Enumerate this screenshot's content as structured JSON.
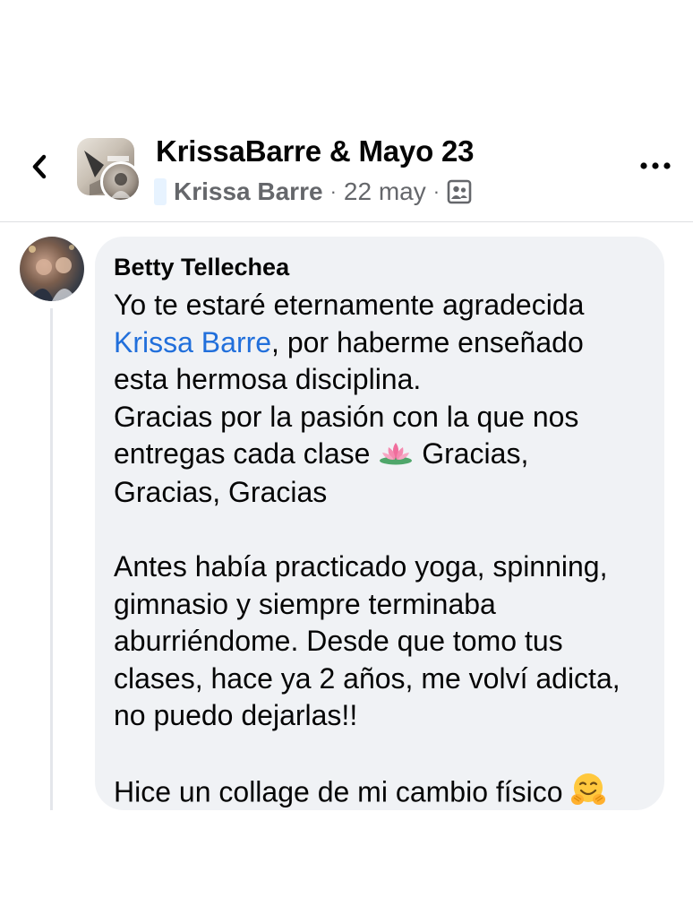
{
  "header": {
    "title": "KrissaBarre & Mayo 23",
    "author": "Krissa Barre",
    "date": "22 may",
    "separator": "·",
    "audience_icon": "group-audience-icon",
    "back_icon": "chevron-left-icon",
    "more_icon": "more-horizontal-icon"
  },
  "comment": {
    "author": "Betty Tellechea",
    "line_1": "Yo te estaré eternamente agradecida",
    "mention": "Krissa Barre",
    "line_2_rest": ", por haberme enseñado",
    "line_3": "esta hermosa disciplina.",
    "line_4": "Gracias por la pasión con la que nos",
    "line_5_start": "entregas cada clase ",
    "lotus_icon": "lotus-emoji-icon",
    "line_5_end": " Gracias,",
    "line_6": "Gracias, Gracias",
    "line_7": "Antes había practicado yoga, spinning,",
    "line_8": "gimnasio y siempre terminaba",
    "line_9": "aburriéndome. Desde que tomo tus",
    "line_10": "clases, hace ya 2 años, me volví adicta,",
    "line_11": "no puedo dejarlas!!",
    "line_12": "Hice un collage de mi cambio físico ",
    "hug_icon": "hugging-face-emoji-icon"
  },
  "colors": {
    "mention": "#216fdb",
    "bubble": "#f0f2f5",
    "meta_text": "#65676b"
  }
}
